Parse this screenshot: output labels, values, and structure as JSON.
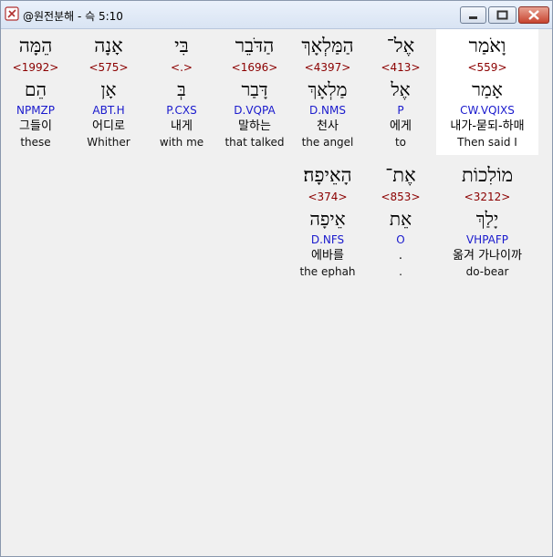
{
  "window": {
    "title": "@원전분해 - 슥 5:10"
  },
  "rows": [
    {
      "columns": [
        {
          "heb": "וָאֹמַר",
          "strong": "<559>",
          "lemma": "אָמַר",
          "parse": "CW.VQIXS",
          "kor": "내가-묻되-하매",
          "eng": "Then said I",
          "highlight": true
        },
        {
          "heb": "אֶל־",
          "strong": "<413>",
          "lemma": "אֶל",
          "parse": "P",
          "kor": "에게",
          "eng": "to",
          "highlight": false
        },
        {
          "heb": "הַמַּלְאָךְ",
          "strong": "<4397>",
          "lemma": "מַלְאָךְ",
          "parse": "D.NMS",
          "kor": "천사",
          "eng": "the angel",
          "highlight": false
        },
        {
          "heb": "הַדֹּבֵר",
          "strong": "<1696>",
          "lemma": "דָּבַר",
          "parse": "D.VQPA",
          "kor": "말하는",
          "eng": "that talked",
          "highlight": false
        },
        {
          "heb": "בִּי",
          "strong": "<.>",
          "lemma": "בְּ",
          "parse": "P.CXS",
          "kor": "내게",
          "eng": "with me",
          "highlight": false
        },
        {
          "heb": "אָנָה",
          "strong": "<575>",
          "lemma": "אָן",
          "parse": "ABT.H",
          "kor": "어디로",
          "eng": "Whither",
          "highlight": false
        },
        {
          "heb": "הֵמָּה",
          "strong": "<1992>",
          "lemma": "הֵם",
          "parse": "NPMZP",
          "kor": "그들이",
          "eng": "these",
          "highlight": false
        }
      ]
    },
    {
      "columns": [
        {
          "heb": "מוֹלִכוֹת",
          "strong": "<3212>",
          "lemma": "יָלַךְ",
          "parse": "VHPAFP",
          "kor": "옮겨 가나이까",
          "eng": "do-bear",
          "highlight": false
        },
        {
          "heb": "אֶת־",
          "strong": "<853>",
          "lemma": "אֵת",
          "parse": "O",
          "kor": ".",
          "eng": ".",
          "highlight": false
        },
        {
          "heb": "הָאֵיפָה׃",
          "strong": "<374>",
          "lemma": "אֵיפָה",
          "parse": "D.NFS",
          "kor": "에바를",
          "eng": "the ephah",
          "highlight": false
        }
      ]
    }
  ]
}
